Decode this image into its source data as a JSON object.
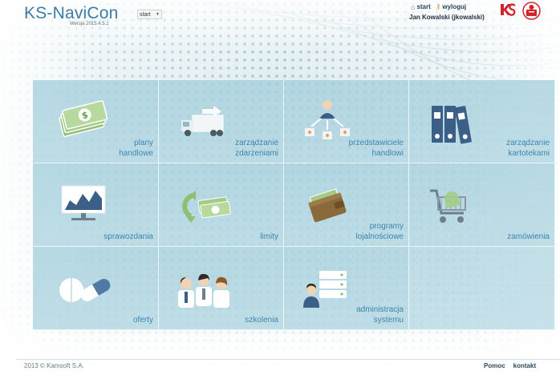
{
  "app": {
    "title": "KS-NaviCon",
    "version": "Wersja 2015.4.5.1",
    "start_select": "start"
  },
  "header": {
    "start_link": "start",
    "logout_link": "wyloguj",
    "username": "Jan Kowalski (jkowalski)"
  },
  "tiles": [
    {
      "label": "plany\nhandlowe",
      "icon": "money-stack-icon"
    },
    {
      "label": "zarządzanie\nzdarzeniami",
      "icon": "delivery-truck-icon"
    },
    {
      "label": "przedstawiciele\nhandlowi",
      "icon": "sales-reps-network-icon"
    },
    {
      "label": "zarządzanie\nkartotekami",
      "icon": "binders-icon"
    },
    {
      "label": "sprawozdania",
      "icon": "chart-board-icon"
    },
    {
      "label": "limity",
      "icon": "money-cycle-icon"
    },
    {
      "label": "programy\nlojalnościowe",
      "icon": "wallet-icon"
    },
    {
      "label": "zamówienia",
      "icon": "shopping-cart-icon"
    },
    {
      "label": "oferty",
      "icon": "pills-icon"
    },
    {
      "label": "szkolenia",
      "icon": "people-group-icon"
    },
    {
      "label": "administracja\nsystemu",
      "icon": "servers-admin-icon"
    }
  ],
  "footer": {
    "copyright": "2013 © Kamsoft S.A.",
    "help_link": "Pomoc",
    "contact_link": "kontakt"
  },
  "colors": {
    "accent": "#3e84ad",
    "tile": "#a9d2de",
    "logo_text": "#3d7ca6"
  }
}
